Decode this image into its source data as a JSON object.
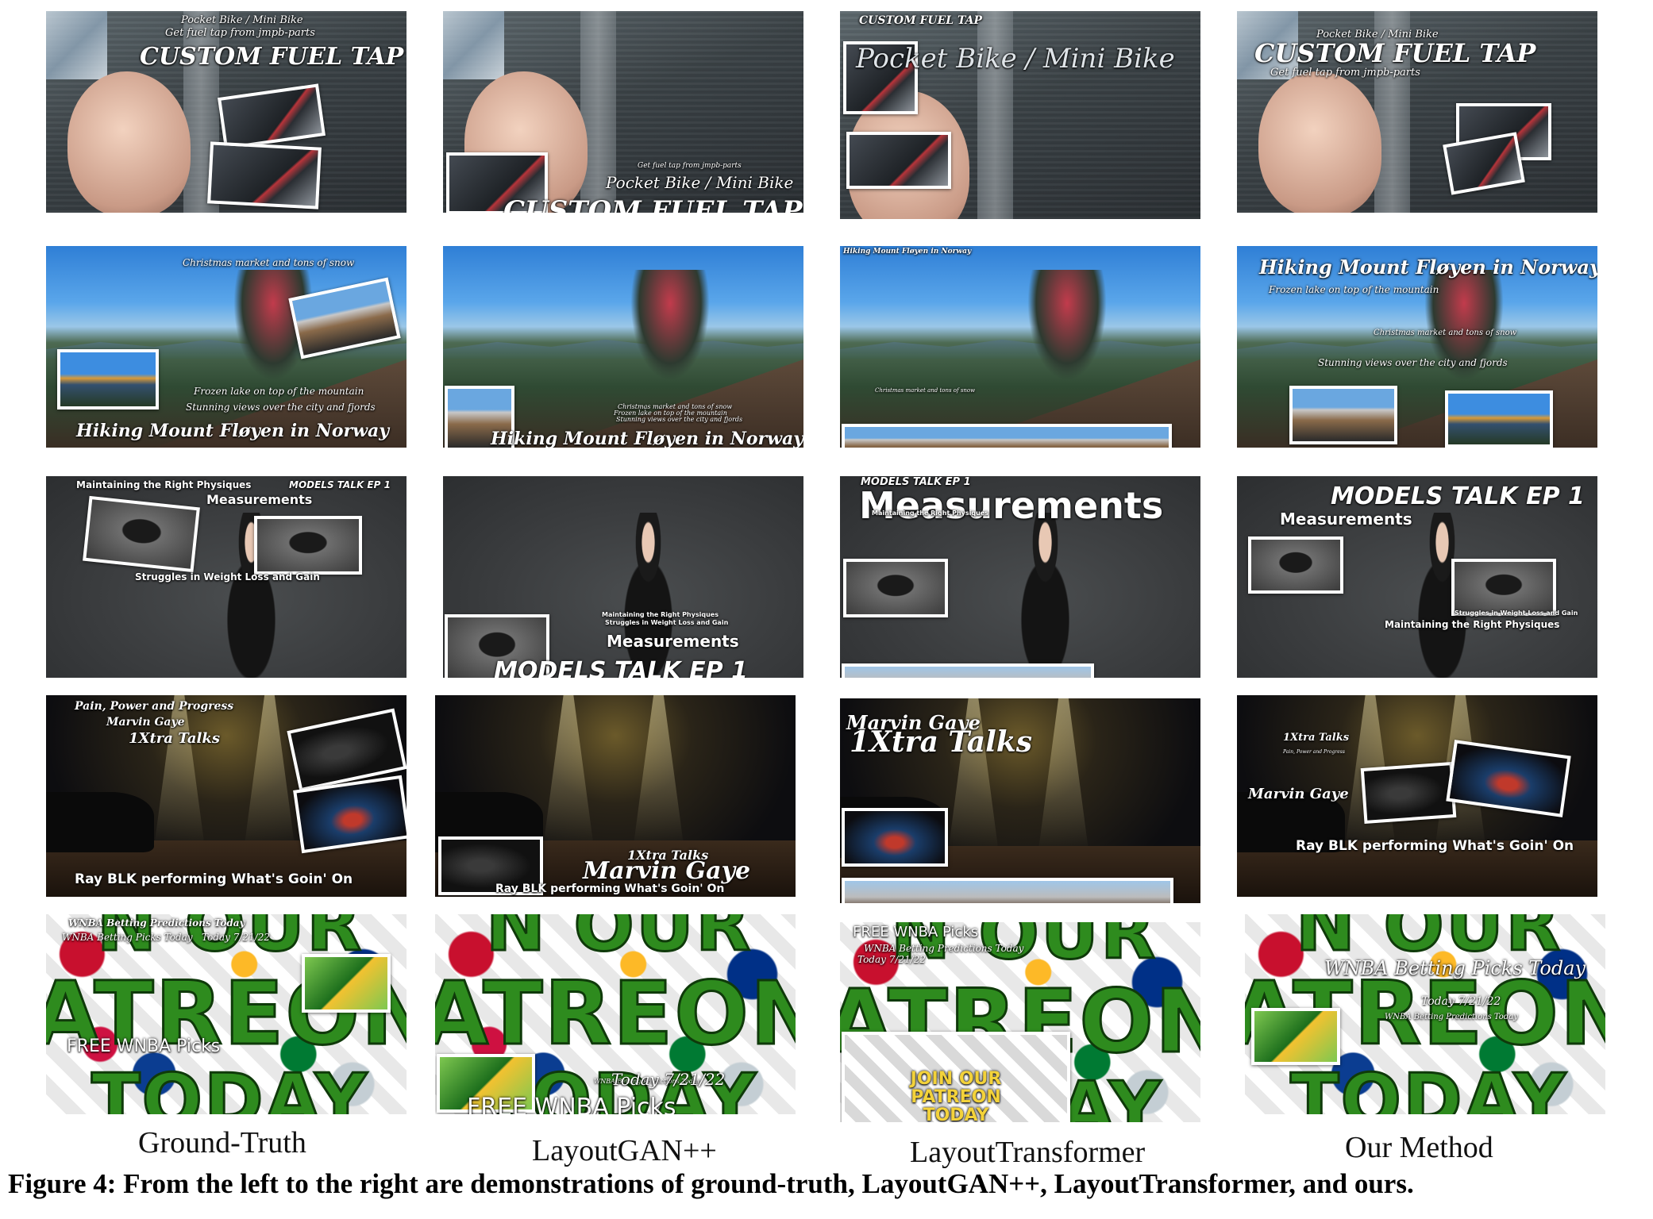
{
  "columns": {
    "ground_truth": "Ground-Truth",
    "layoutgan": "LayoutGAN++",
    "layouttransformer": "LayoutTransformer",
    "ours": "Our Method"
  },
  "rows": {
    "bike": {
      "series_title": "Pocket Bike / Mini Bike",
      "subtitle": "Get fuel tap from jmpb-parts",
      "title": "Custom Fuel Tap",
      "title_caps": "CUSTOM FUEL TAP"
    },
    "hike": {
      "title": "Hiking Mount Fløyen in Norway",
      "line1": "Christmas market and tons of snow",
      "line2": "Frozen lake on top of the mountain",
      "line3": "Stunning views over the city and fjords"
    },
    "models": {
      "episode": "MODELS TALK EP 1",
      "episode_alt": "MODELS TALK EP 1",
      "heading": "Measurements",
      "line1": "Maintaining the Right Physiques",
      "line2": "Struggles in Weight Loss and Gain"
    },
    "music": {
      "line1": "Pain, Power and Progress",
      "artist": "Marvin Gaye",
      "show": "1Xtra Talks",
      "performance": "Ray BLK performing What's Goin' On"
    },
    "wnba": {
      "line1": "WNBA Betting Predictions Today",
      "line2": "WNBA Betting Picks Today",
      "date": "Today 7/21/22",
      "free": "FREE WNBA Picks",
      "bg_word1": "N OUR",
      "bg_word2": "ATREON",
      "bg_word3": "TODAY",
      "logo": "JOIN OUR PATREON TODAY"
    }
  },
  "caption": "Figure 4: From the left to the right are demonstrations of ground-truth, LayoutGAN++, LayoutTransformer, and ours."
}
